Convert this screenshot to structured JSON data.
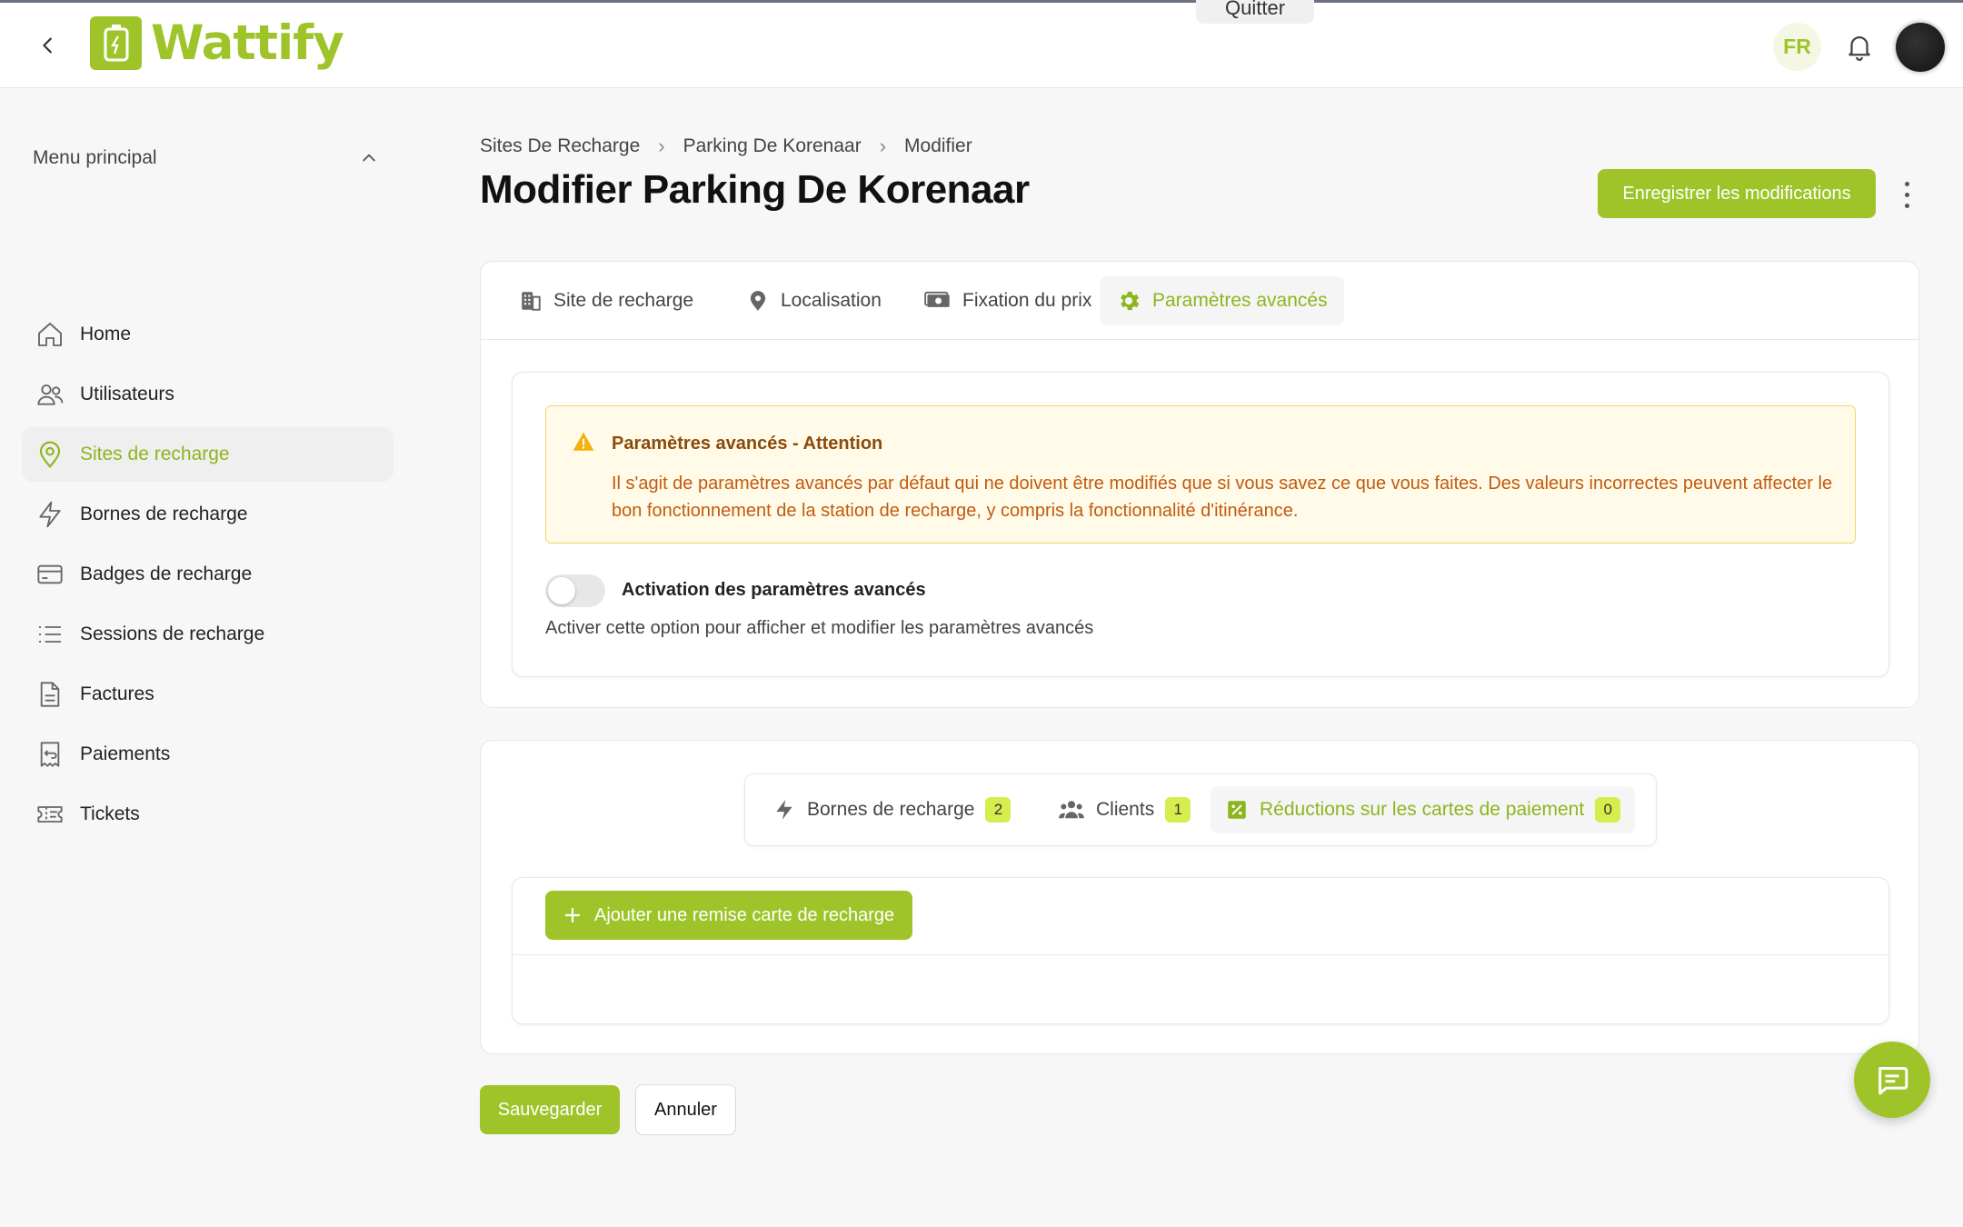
{
  "app": {
    "name": "Wattify",
    "brand_color": "#9fc42a"
  },
  "topbar": {
    "quit_label": "Quitter",
    "lang": "FR"
  },
  "sidebar": {
    "menu_title": "Menu principal",
    "items": [
      {
        "label": "Home",
        "icon": "home-icon",
        "active": false
      },
      {
        "label": "Utilisateurs",
        "icon": "users-icon",
        "active": false
      },
      {
        "label": "Sites de recharge",
        "icon": "map-pin-icon",
        "active": true
      },
      {
        "label": "Bornes de recharge",
        "icon": "bolt-icon",
        "active": false
      },
      {
        "label": "Badges de recharge",
        "icon": "card-icon",
        "active": false
      },
      {
        "label": "Sessions de recharge",
        "icon": "list-icon",
        "active": false
      },
      {
        "label": "Factures",
        "icon": "invoice-icon",
        "active": false
      },
      {
        "label": "Paiements",
        "icon": "receipt-icon",
        "active": false
      },
      {
        "label": "Tickets",
        "icon": "ticket-icon",
        "active": false
      }
    ]
  },
  "breadcrumb": [
    "Sites De Recharge",
    "Parking De Korenaar",
    "Modifier"
  ],
  "page": {
    "title": "Modifier Parking De Korenaar",
    "save_changes_label": "Enregistrer les modifications"
  },
  "tabs": [
    {
      "label": "Site de recharge",
      "icon": "building-icon",
      "active": false
    },
    {
      "label": "Localisation",
      "icon": "location-icon",
      "active": false
    },
    {
      "label": "Fixation du prix",
      "icon": "money-icon",
      "active": false
    },
    {
      "label": "Paramètres avancés",
      "icon": "gear-icon",
      "active": true
    }
  ],
  "alert": {
    "title": "Paramètres avancés - Attention",
    "body": "Il s'agit de paramètres avancés par défaut qui ne doivent être modifiés que si vous savez ce que vous faites. Des valeurs incorrectes peuvent affecter le bon fonctionnement de la station de recharge, y compris la fonctionnalité d'itinérance."
  },
  "advanced_toggle": {
    "label": "Activation des paramètres avancés",
    "help": "Activer cette option pour afficher et modifier les paramètres avancés",
    "enabled": false
  },
  "subtabs": [
    {
      "label": "Bornes de recharge",
      "count": "2",
      "icon": "bolt-icon",
      "active": false
    },
    {
      "label": "Clients",
      "count": "1",
      "icon": "users-icon",
      "active": false
    },
    {
      "label": "Réductions sur les cartes de paiement",
      "count": "0",
      "icon": "discount-icon",
      "active": true
    }
  ],
  "add_discount_label": "Ajouter une remise carte de recharge",
  "footer": {
    "save_label": "Sauvegarder",
    "cancel_label": "Annuler"
  }
}
